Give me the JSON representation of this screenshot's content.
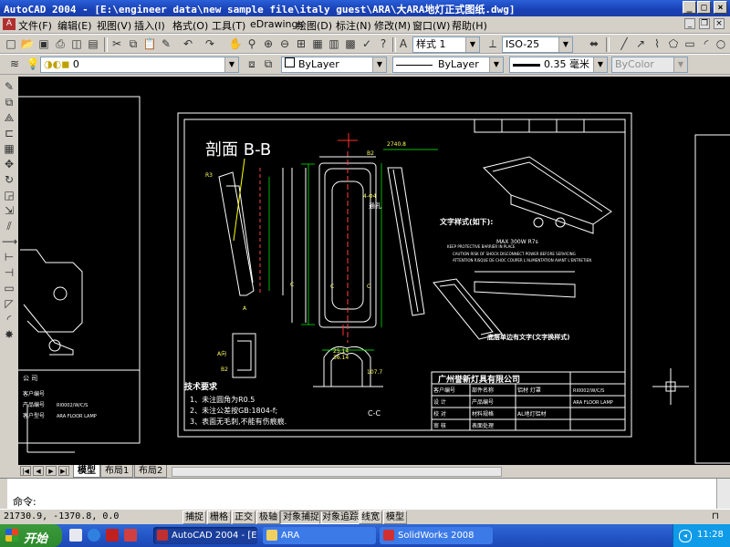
{
  "window": {
    "title": "AutoCAD 2004 - [E:\\engineer data\\new sample file\\italy guest\\ARA\\大ARA地灯正式图纸.dwg]",
    "controls": [
      "_",
      "□",
      "×"
    ]
  },
  "menu": {
    "items": [
      "文件(F)",
      "编辑(E)",
      "视图(V)",
      "插入(I)",
      "格式(O)",
      "工具(T)",
      "eDrawings",
      "绘图(D)",
      "标注(N)",
      "修改(M)",
      "窗口(W)",
      "帮助(H)"
    ]
  },
  "toolbar": {
    "text_style": "样式 1",
    "dim_style": "ISO-25"
  },
  "properties": {
    "layer": "0",
    "color": "ByLayer",
    "linetype": "ByLayer",
    "lineweight": "0.35 毫米",
    "plotstyle": "ByColor"
  },
  "drawing": {
    "section_title": "剖面 B-B",
    "section_cc": "C-C",
    "tech_title": "技术要求",
    "tech_lines": [
      "1、未注圆角为R0.5",
      "2、未注公差按GB:1804-f;",
      "3、表面无毛刺,不能有伤痕痕."
    ],
    "text_style_title": "文字样式(如下):",
    "label_max": "MAX 300W R7s",
    "warn_text": [
      "KEEP PROTECTIVE BARRIER IN PLACE",
      "CAUTION RISK OF SHOCK DISCONNECT POWER BEFORE SERVICING",
      "ATTENTION RISQUE DE CHOC COUPER L'ALIMENTATION AVANT L'ENTRETIEN"
    ],
    "label_hole": "通孔",
    "label_bottom": "底层单边有文字(文字换样式)",
    "company": "广州誉新灯具有限公司",
    "title_rows": [
      [
        "客户编号",
        "",
        "部件名称",
        "铝材 灯罩"
      ],
      [
        "设 计",
        "",
        "产品编号",
        "RI0002/W/C/S"
      ],
      [
        "校 对",
        "",
        "材料规格",
        "AL地灯铝材"
      ],
      [
        "审 核",
        "",
        "表面处理",
        ""
      ]
    ],
    "product_type": "ARA FLOOR LAMP",
    "left_rows": [
      "客户编号",
      "产品编号",
      "客户型号"
    ],
    "left_values": [
      "",
      "RI0002/W/C/S",
      "ARA FLOOR LAMP"
    ],
    "left_company": "公 司",
    "dims": [
      "2740.8",
      "B2",
      "R3",
      "A",
      "C",
      "C",
      "C",
      "36.14",
      "25.14",
      "4-Φ4",
      "107.7",
      "B2",
      "A向"
    ]
  },
  "layout_tabs": {
    "items": [
      "模型",
      "布局1",
      "布局2"
    ],
    "active": "模型"
  },
  "command": {
    "prompt": "命令:"
  },
  "status": {
    "coords": "21730.9, -1370.8, 0.0",
    "toggles": [
      "捕捉",
      "栅格",
      "正交",
      "极轴",
      "对象捕捉",
      "对象追踪",
      "线宽",
      "模型"
    ]
  },
  "taskbar": {
    "start": "开始",
    "tasks": [
      "AutoCAD 2004 - [E:\\...",
      "ARA",
      "SolidWorks 2008"
    ],
    "clock": "11:28"
  },
  "colors": {
    "titlebar": "#1f4fc4",
    "drawing_bg": "#000000",
    "taskbar": "#2456c7",
    "start": "#3c9a3c"
  }
}
